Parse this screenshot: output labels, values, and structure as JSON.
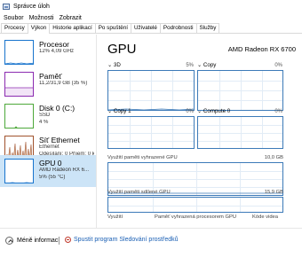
{
  "window": {
    "title": "Správce úloh"
  },
  "menu": [
    {
      "label": "Soubor"
    },
    {
      "label": "Možnosti"
    },
    {
      "label": "Zobrazit"
    }
  ],
  "tabs": [
    {
      "label": "Procesy",
      "active": false
    },
    {
      "label": "Výkon",
      "active": true
    },
    {
      "label": "Historie aplikací",
      "active": false
    },
    {
      "label": "Po spuštění",
      "active": false
    },
    {
      "label": "Uživatelé",
      "active": false
    },
    {
      "label": "Podrobnosti",
      "active": false
    },
    {
      "label": "Služby",
      "active": false
    }
  ],
  "sidebar": {
    "items": [
      {
        "name": "Procesor",
        "sub1": "12% 4,09 GHz",
        "sub2": "",
        "sub3": "",
        "color": "#1874cd"
      },
      {
        "name": "Paměť",
        "sub1": "11,2/31,9 GB (35 %)",
        "sub2": "",
        "sub3": "",
        "color": "#8b2bb0"
      },
      {
        "name": "Disk 0 (C:)",
        "sub1": "SSD",
        "sub2": "4 %",
        "sub3": "",
        "color": "#4da83a"
      },
      {
        "name": "Síť Ethernet",
        "sub1": "Ethernet",
        "sub2": "Odesílání: 0 Příjem: 0 kb",
        "sub3": "",
        "color": "#a0522d"
      },
      {
        "name": "GPU 0",
        "sub1": "AMD Radeon RX 6...",
        "sub2": "5% (55 °C)",
        "sub3": "",
        "color": "#1874cd"
      }
    ]
  },
  "main": {
    "title": "GPU",
    "model": "AMD Radeon RX 6700",
    "engines": [
      {
        "label": "3D",
        "pct": "5%"
      },
      {
        "label": "Copy",
        "pct": "0%"
      },
      {
        "label": "Copy 1",
        "pct": "0%"
      },
      {
        "label": "Compute 0",
        "pct": "0%"
      }
    ],
    "dedicated": {
      "label": "Využití paměti vyhrazené GPU",
      "value": "10,0 GB"
    },
    "shared": {
      "label": "Využití paměti sdílené GPU",
      "value": "15,9 GB"
    },
    "bottom": {
      "util": "Využití",
      "dedicated_mem": "Paměť vyhrazená procesorem GPU",
      "video": "Kóde videa"
    }
  },
  "footer": {
    "less_info": "Méně informací",
    "monitor": "Spustit program Sledování prostředků"
  },
  "colors": {
    "accent": "#3c7ab8",
    "selected": "#cce4f7",
    "link": "#1a5fb4"
  }
}
